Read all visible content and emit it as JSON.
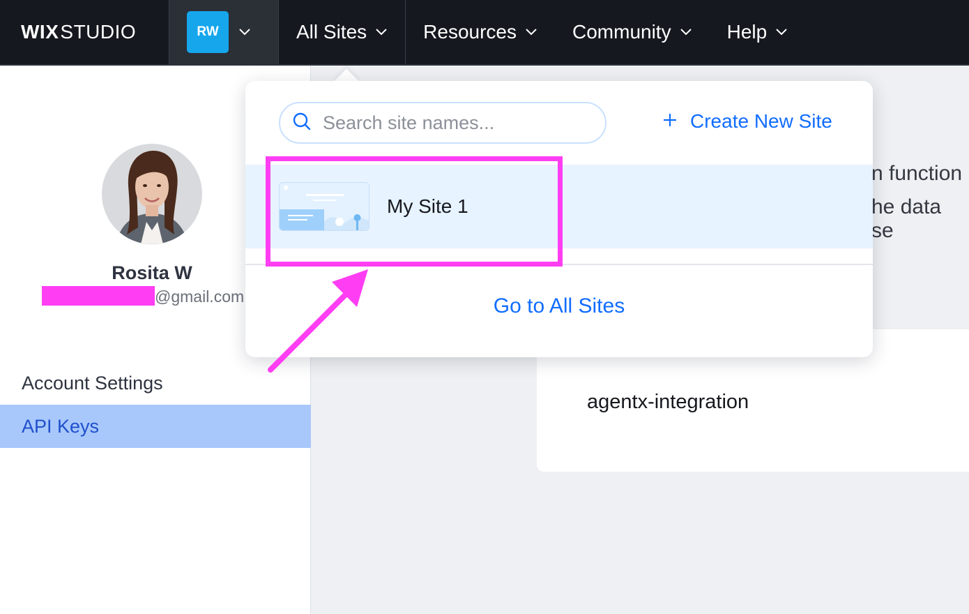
{
  "topbar": {
    "logo_wix": "WIX",
    "logo_studio": "STUDIO",
    "account_initials": "RW",
    "nav": [
      {
        "label": "All Sites"
      },
      {
        "label": "Resources"
      },
      {
        "label": "Community"
      },
      {
        "label": "Help"
      }
    ]
  },
  "sidebar": {
    "user_name": "Rosita W",
    "email_suffix": "@gmail.com",
    "menu": [
      {
        "label": "Account Settings"
      },
      {
        "label": "API Keys"
      }
    ]
  },
  "main": {
    "background_text_1": "n function",
    "background_text_2": "he data se",
    "card_title": "agentx-integration"
  },
  "dropdown": {
    "search_placeholder": "Search site names...",
    "create_label": "Create New Site",
    "sites": [
      {
        "name": "My Site 1"
      }
    ],
    "go_to_all_label": "Go to All Sites"
  },
  "colors": {
    "topbar_bg": "#15191f",
    "accent_blue": "#116dff",
    "avatar_blue": "#15a6ec",
    "active_menu_bg": "#a8c8fc",
    "annotation_magenta": "#ff3ef3"
  },
  "icons": {
    "search": "search-icon",
    "plus": "plus-icon",
    "chevron": "chevron-down-icon"
  }
}
